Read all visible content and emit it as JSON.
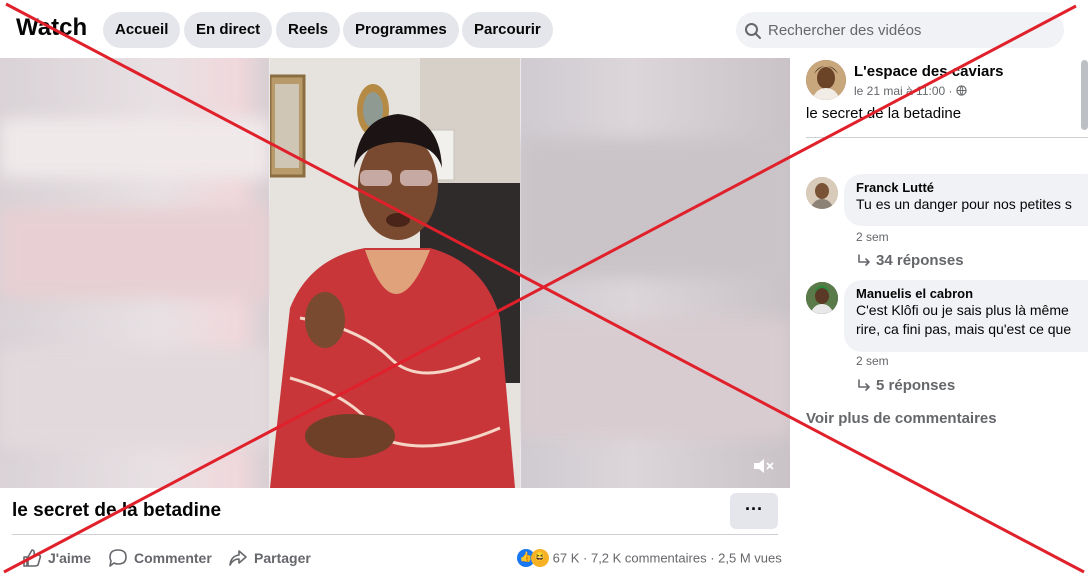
{
  "header": {
    "title": "Watch",
    "nav": [
      "Accueil",
      "En direct",
      "Reels",
      "Programmes",
      "Parcourir"
    ],
    "search_placeholder": "Rechercher des vidéos"
  },
  "post": {
    "page_name": "L'espace des caviars",
    "date": "le 21 mai à 11:00 ·",
    "text": "le secret de la betadine",
    "video_title": "le secret de la betadine",
    "more_label": "···",
    "actions": {
      "like": "J'aime",
      "comment": "Commenter",
      "share": "Partager"
    },
    "stats": {
      "reactions": "67 K",
      "sep1": "·",
      "comments": "7,2 K commentaires",
      "sep2": "·",
      "views": "2,5 M vues"
    }
  },
  "comments": [
    {
      "author": "Franck Lutté",
      "text": "Tu es un danger pour nos petites s",
      "time": "2 sem",
      "replies": "34 réponses"
    },
    {
      "author": "Manuelis el cabron",
      "text_line1": "C'est Klôfi ou je sais plus là même",
      "text_line2": "rire, ca fini pas, mais qu'est ce que",
      "time": "2 sem",
      "replies": "5 réponses"
    }
  ],
  "see_more": "Voir plus de commentaires",
  "colors": {
    "accent": "#1877f2",
    "cross": "#e0202a",
    "pill_bg": "#e4e6eb",
    "secondary_text": "#65676b"
  },
  "icons": [
    "search-icon",
    "globe-icon",
    "mute-icon",
    "like-icon",
    "comment-icon",
    "share-icon",
    "reply-arrow-icon",
    "like-reaction-icon",
    "haha-reaction-icon"
  ]
}
